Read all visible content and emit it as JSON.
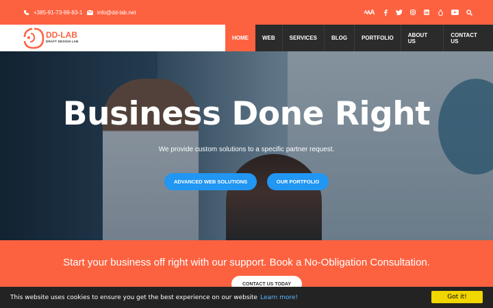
{
  "topbar": {
    "phone": "+385-91-73-99-83-1",
    "email": "info@dd-lab.net",
    "font_size_small": "A",
    "font_size_mid": "A",
    "font_size_large": "A",
    "social_icons": [
      "facebook-icon",
      "twitter-icon",
      "instagram-icon",
      "linkedin-icon",
      "drupal-icon",
      "youtube-icon",
      "search-icon"
    ]
  },
  "logo": {
    "name": "DD-LAB",
    "tagline": "DRAFT DESIGN LAB"
  },
  "nav": {
    "items": [
      "HOME",
      "WEB",
      "SERVICES",
      "BLOG",
      "PORTFOLIO",
      "ABOUT US",
      "CONTACT US"
    ],
    "active": "HOME"
  },
  "hero": {
    "title": "Business Done Right",
    "subtitle": "We provide custom solutions to a specific partner request.",
    "btn_web": "ADVANCED WEB SOLUTIONS",
    "btn_portfolio": "OUR PORTFOLIO"
  },
  "cta": {
    "text": "Start your business off right with our support. Book a No-Obligation Consultation.",
    "button": "CONTACT US TODAY"
  },
  "cookie": {
    "message": "This website uses cookies to ensure you get the best experience on our website",
    "link": "Learn more!",
    "button": "Got it!"
  },
  "colors": {
    "accent": "#fd6240",
    "button_blue": "#2196f3",
    "nav_dark": "#2b2b2b",
    "cookie_bg": "#232323",
    "cookie_button": "#f1d600"
  }
}
